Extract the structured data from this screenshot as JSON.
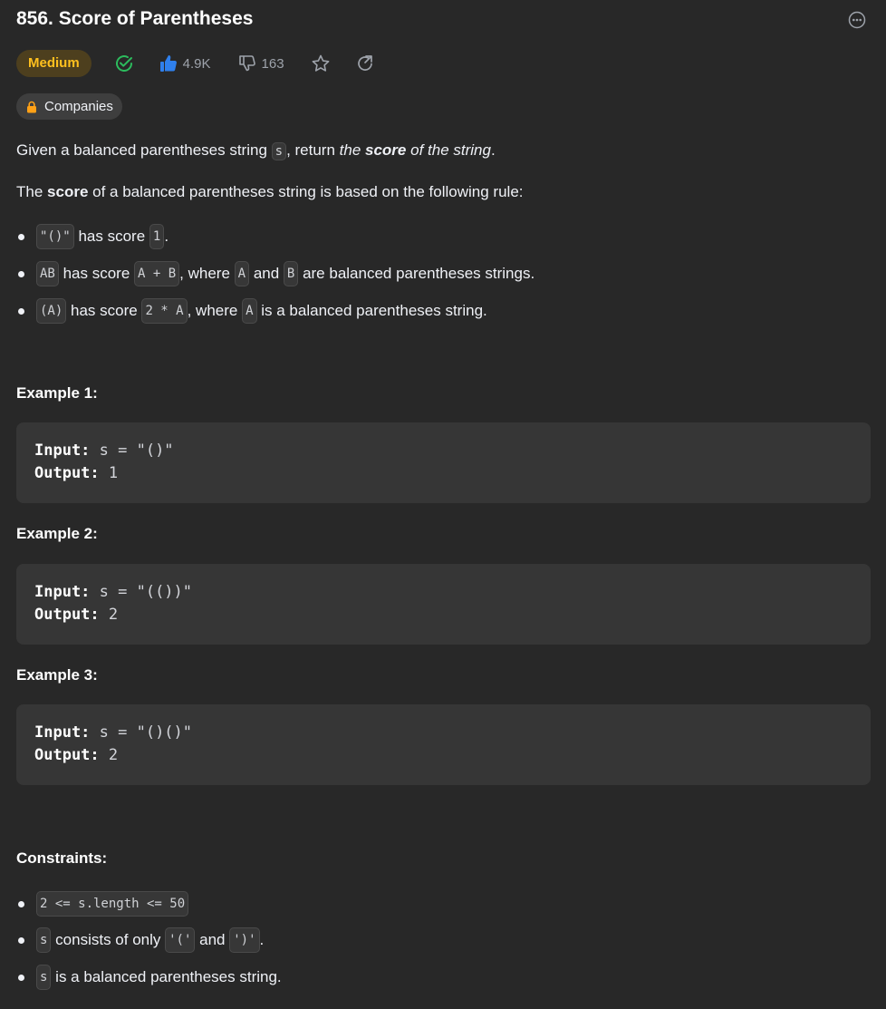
{
  "problem": {
    "title": "856. Score of Parentheses",
    "difficulty": "Medium",
    "likes": "4.9K",
    "dislikes": "163",
    "companies_label": "Companies"
  },
  "description": {
    "intro": {
      "pre": "Given a balanced parentheses string ",
      "code": "s",
      "mid": ", return ",
      "i1": "the ",
      "bi": "score",
      "i2": " of the string",
      "end": "."
    },
    "rule_line": {
      "pre": "The ",
      "b": "score",
      "post": " of a balanced parentheses string is based on the following rule:"
    },
    "rules": [
      {
        "c1": "\"()\"",
        "t1": " has score ",
        "c2": "1",
        "t2": "."
      },
      {
        "c1": "AB",
        "t1": " has score ",
        "c2": "A + B",
        "t2": ", where ",
        "c3": "A",
        "t3": " and ",
        "c4": "B",
        "t4": " are balanced parentheses strings."
      },
      {
        "c1": "(A)",
        "t1": " has score ",
        "c2": "2 * A",
        "t2": ", where ",
        "c3": "A",
        "t3": " is a balanced parentheses string."
      }
    ]
  },
  "examples": [
    {
      "heading": "Example 1:",
      "input_label": "Input:",
      "input_value": " s = \"()\"",
      "output_label": "Output:",
      "output_value": " 1"
    },
    {
      "heading": "Example 2:",
      "input_label": "Input:",
      "input_value": " s = \"(())\"",
      "output_label": "Output:",
      "output_value": " 2"
    },
    {
      "heading": "Example 3:",
      "input_label": "Input:",
      "input_value": " s = \"()()\"",
      "output_label": "Output:",
      "output_value": " 2"
    }
  ],
  "constraints": {
    "heading": "Constraints:",
    "items": [
      {
        "c1": "2 <= s.length <= 50"
      },
      {
        "c1": "s",
        "t1": " consists of only ",
        "c2": "'('",
        "t2": " and ",
        "c3": "')'",
        "t3": "."
      },
      {
        "c1": "s",
        "t1": " is a balanced parentheses string."
      }
    ]
  },
  "icons": {
    "more": "more-options-icon",
    "solved": "check-circle-icon",
    "like": "thumbs-up-icon",
    "dislike": "thumbs-down-icon",
    "favorite": "star-icon",
    "share": "share-icon",
    "lock": "lock-icon"
  },
  "colors": {
    "background": "#282828",
    "medium": "#ffc01e",
    "solved": "#2cbb5d",
    "like": "#2f80ed"
  }
}
